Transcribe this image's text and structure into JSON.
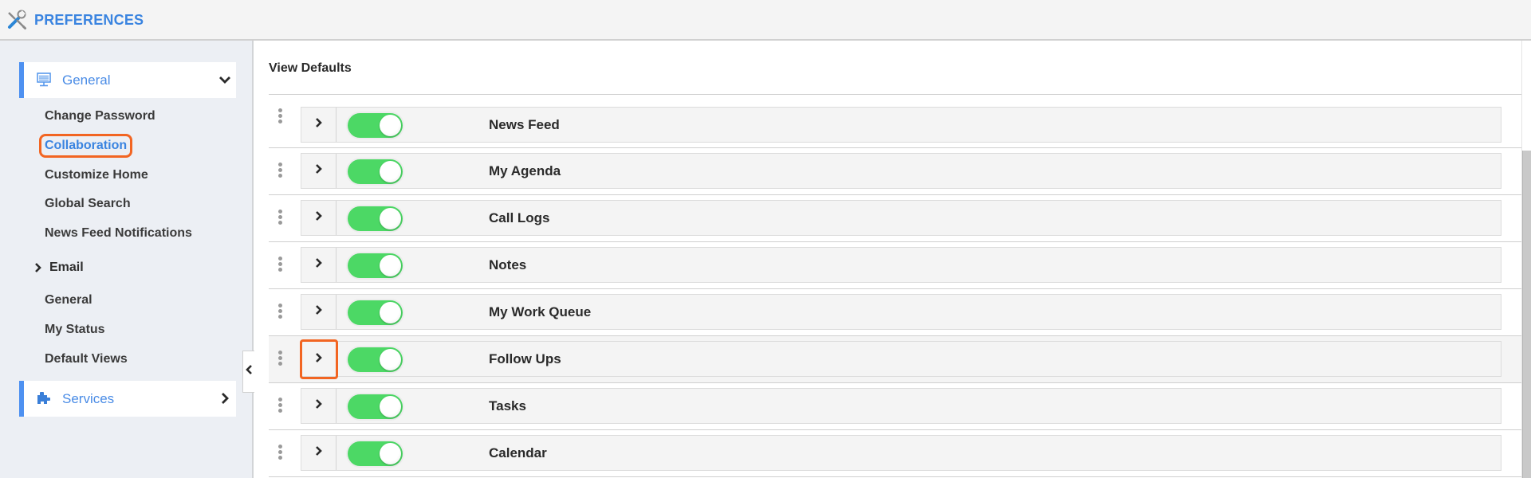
{
  "header": {
    "title": "PREFERENCES",
    "icon": "tools-icon"
  },
  "sidebar": {
    "sections": [
      {
        "label": "General",
        "icon": "monitor-icon",
        "expanded": true,
        "chevron": "chevron-down-icon",
        "items": [
          {
            "label": "Change Password",
            "active": false
          },
          {
            "label": "Collaboration",
            "active": true
          },
          {
            "label": "Customize Home",
            "active": false
          },
          {
            "label": "Global Search",
            "active": false
          },
          {
            "label": "News Feed Notifications",
            "active": false
          }
        ],
        "groups": [
          {
            "label": "Email",
            "chevron": "chevron-right-icon",
            "expanded": false
          }
        ],
        "items_after": [
          {
            "label": "General",
            "active": false
          },
          {
            "label": "My Status",
            "active": false
          },
          {
            "label": "Default Views",
            "active": false
          }
        ]
      },
      {
        "label": "Services",
        "icon": "puzzle-icon",
        "expanded": false,
        "chevron": "chevron-right-icon"
      }
    ],
    "collapse_icon": "chevron-left-icon"
  },
  "main": {
    "title": "View Defaults",
    "rows": [
      {
        "label": "News Feed",
        "enabled": true,
        "focused": false
      },
      {
        "label": "My Agenda",
        "enabled": true,
        "focused": false
      },
      {
        "label": "Call Logs",
        "enabled": true,
        "focused": false
      },
      {
        "label": "Notes",
        "enabled": true,
        "focused": false
      },
      {
        "label": "My Work Queue",
        "enabled": true,
        "focused": false
      },
      {
        "label": "Follow Ups",
        "enabled": true,
        "focused": true
      },
      {
        "label": "Tasks",
        "enabled": true,
        "focused": false
      },
      {
        "label": "Calendar",
        "enabled": true,
        "focused": false
      }
    ]
  },
  "colors": {
    "accent": "#3a84e0",
    "section_bar": "#4e91f1",
    "toggle_on": "#4cd865",
    "highlight_outline": "#f26522",
    "sidebar_bg": "#eceff4",
    "row_bg": "#f4f4f4"
  }
}
